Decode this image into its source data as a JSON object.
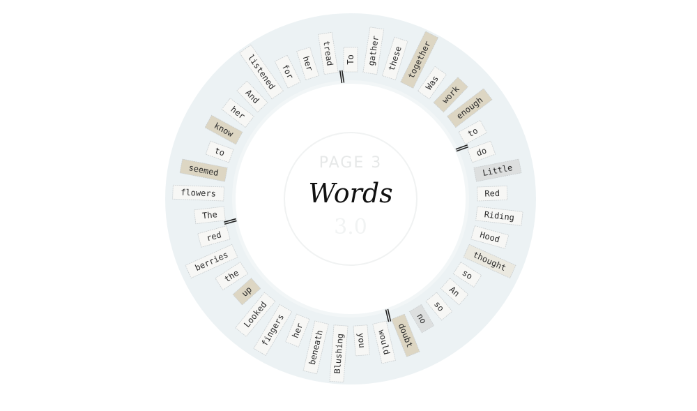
{
  "center": {
    "page_label": "PAGE 3",
    "title": "Words",
    "watermark": "3.0"
  },
  "colors": {
    "ring": "#ecf2f4",
    "tile_normal": "#f7f7f5",
    "tile_tan": "#ddd6c3",
    "tile_light": "#ebe9e0",
    "tile_gray": "#dddfdf",
    "tile_border": "#c9ced0",
    "text": "#2b2b2b",
    "separator": "#222222"
  },
  "words": [
    {
      "text": "To",
      "style": "normal"
    },
    {
      "text": "gather",
      "style": "normal"
    },
    {
      "text": "these",
      "style": "normal"
    },
    {
      "text": "together",
      "style": "tan"
    },
    {
      "text": "Was",
      "style": "normal"
    },
    {
      "text": "work",
      "style": "tan"
    },
    {
      "text": "enough",
      "style": "tan"
    },
    {
      "text": "to",
      "style": "normal"
    },
    {
      "text": "do",
      "style": "normal",
      "sep_before": true
    },
    {
      "text": "Little",
      "style": "gray"
    },
    {
      "text": "Red",
      "style": "normal"
    },
    {
      "text": "Riding",
      "style": "normal"
    },
    {
      "text": "Hood",
      "style": "normal"
    },
    {
      "text": "thought",
      "style": "light"
    },
    {
      "text": "so",
      "style": "normal"
    },
    {
      "text": "An",
      "style": "normal"
    },
    {
      "text": "so",
      "style": "normal"
    },
    {
      "text": "no",
      "style": "gray"
    },
    {
      "text": "doubt",
      "style": "tan"
    },
    {
      "text": "would",
      "style": "normal",
      "sep_before": true
    },
    {
      "text": "you",
      "style": "normal"
    },
    {
      "text": "Blushing",
      "style": "normal"
    },
    {
      "text": "beneath",
      "style": "normal"
    },
    {
      "text": "her",
      "style": "normal"
    },
    {
      "text": "fingers",
      "style": "normal"
    },
    {
      "text": "Looked",
      "style": "normal"
    },
    {
      "text": "up",
      "style": "tan"
    },
    {
      "text": "the",
      "style": "normal"
    },
    {
      "text": "berries",
      "style": "normal"
    },
    {
      "text": "red",
      "style": "normal",
      "sep_after": true
    },
    {
      "text": "The",
      "style": "normal"
    },
    {
      "text": "flowers",
      "style": "normal"
    },
    {
      "text": "seemed",
      "style": "tan"
    },
    {
      "text": "to",
      "style": "normal"
    },
    {
      "text": "know",
      "style": "tan"
    },
    {
      "text": "her",
      "style": "normal"
    },
    {
      "text": "And",
      "style": "normal"
    },
    {
      "text": "listened",
      "style": "normal"
    },
    {
      "text": "for",
      "style": "normal"
    },
    {
      "text": "her",
      "style": "normal"
    },
    {
      "text": "tread",
      "style": "normal",
      "sep_after": true
    }
  ]
}
